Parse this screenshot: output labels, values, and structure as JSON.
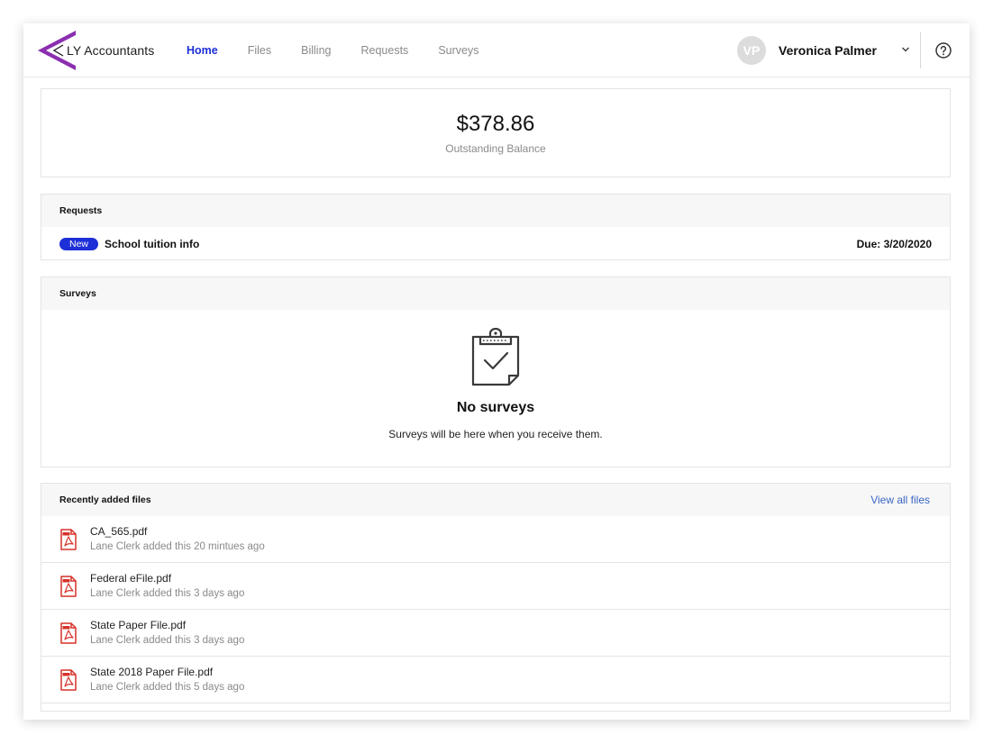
{
  "brand": {
    "name": "LY Accountants",
    "color": "#8b2fb0"
  },
  "nav": {
    "items": [
      {
        "label": "Home",
        "active": true
      },
      {
        "label": "Files",
        "active": false
      },
      {
        "label": "Billing",
        "active": false
      },
      {
        "label": "Requests",
        "active": false
      },
      {
        "label": "Surveys",
        "active": false
      }
    ]
  },
  "user": {
    "initials": "VP",
    "name": "Veronica Palmer"
  },
  "balance": {
    "amount": "$378.86",
    "label": "Outstanding Balance"
  },
  "requests": {
    "title": "Requests",
    "items": [
      {
        "badge": "New",
        "title": "School tuition info",
        "due": "Due: 3/20/2020"
      }
    ]
  },
  "surveys": {
    "title": "Surveys",
    "empty_title": "No surveys",
    "empty_text": "Surveys will be here when you receive them."
  },
  "files": {
    "title": "Recently added files",
    "view_all": "View all files",
    "items": [
      {
        "name": "CA_565.pdf",
        "meta": "Lane Clerk added this 20 mintues ago"
      },
      {
        "name": "Federal eFile.pdf",
        "meta": "Lane Clerk added this 3 days ago"
      },
      {
        "name": "State Paper File.pdf",
        "meta": "Lane Clerk added this 3 days ago"
      },
      {
        "name": "State 2018 Paper File.pdf",
        "meta": "Lane Clerk added this 5 days ago"
      }
    ]
  },
  "colors": {
    "accent": "#1d2fd6",
    "link": "#3a66c4",
    "pdf": "#d6322a"
  }
}
